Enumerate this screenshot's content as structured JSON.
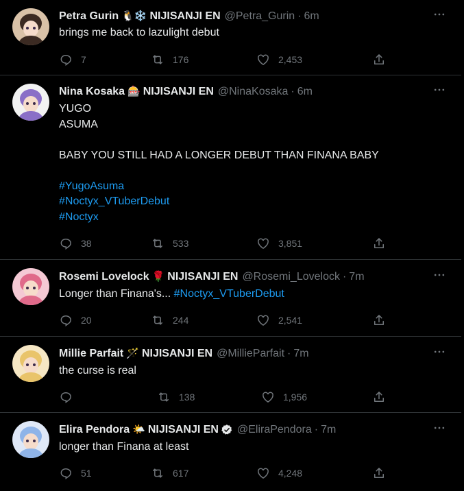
{
  "tweets": [
    {
      "name": "Petra Gurin",
      "emojis": "🐧❄️",
      "org": "NIJISANJI EN",
      "handle": "@Petra_Gurin",
      "time": "6m",
      "lines": [
        "brings me back to lazulight debut"
      ],
      "replies": "7",
      "retweets": "176",
      "likes": "2,453",
      "avatar_colors": [
        "#d9c2a8",
        "#3b2a22"
      ]
    },
    {
      "name": "Nina Kosaka",
      "emojis": "🎰",
      "org": "NIJISANJI EN",
      "handle": "@NinaKosaka",
      "time": "6m",
      "lines": [
        "YUGO",
        "ASUMA",
        "",
        "BABY YOU STILL HAD A LONGER DEBUT THAN FINANA BABY",
        ""
      ],
      "hashtags": [
        "#YugoAsuma",
        "#Noctyx_VTuberDebut",
        "#Noctyx"
      ],
      "replies": "38",
      "retweets": "533",
      "likes": "3,851",
      "avatar_colors": [
        "#f2f2f2",
        "#8a6fc7"
      ]
    },
    {
      "name": "Rosemi Lovelock",
      "emojis": "🌹",
      "org": "NIJISANJI EN",
      "handle": "@Rosemi_Lovelock",
      "time": "7m",
      "text": "Longer than Finana's... ",
      "hashtag_inline": "#Noctyx_VTuberDebut",
      "replies": "20",
      "retweets": "244",
      "likes": "2,541",
      "avatar_colors": [
        "#f4c9d4",
        "#e06a8a"
      ]
    },
    {
      "name": "Millie Parfait",
      "emojis": "🪄",
      "org": "NIJISANJI EN",
      "handle": "@MillieParfait",
      "time": "7m",
      "lines": [
        "the curse is real"
      ],
      "replies": "",
      "retweets": "138",
      "likes": "1,956",
      "avatar_colors": [
        "#f6e7c4",
        "#e9c46a"
      ]
    },
    {
      "name": "Elira Pendora",
      "emojis": "🌤️",
      "org": "NIJISANJI EN",
      "handle": "@EliraPendora",
      "time": "7m",
      "lines": [
        "longer than Finana at least"
      ],
      "replies": "51",
      "retweets": "617",
      "likes": "4,248",
      "verified": true,
      "avatar_colors": [
        "#dfe8f7",
        "#8fb4e8"
      ]
    }
  ],
  "icons": {
    "reply": "reply-icon",
    "retweet": "retweet-icon",
    "like": "heart-icon",
    "share": "share-icon",
    "more": "more-icon",
    "verified": "verified-badge-icon"
  },
  "colors": {
    "background": "#000000",
    "text": "#e7e9ea",
    "muted": "#71767b",
    "link": "#1d9bf0",
    "divider": "#2f3336"
  }
}
